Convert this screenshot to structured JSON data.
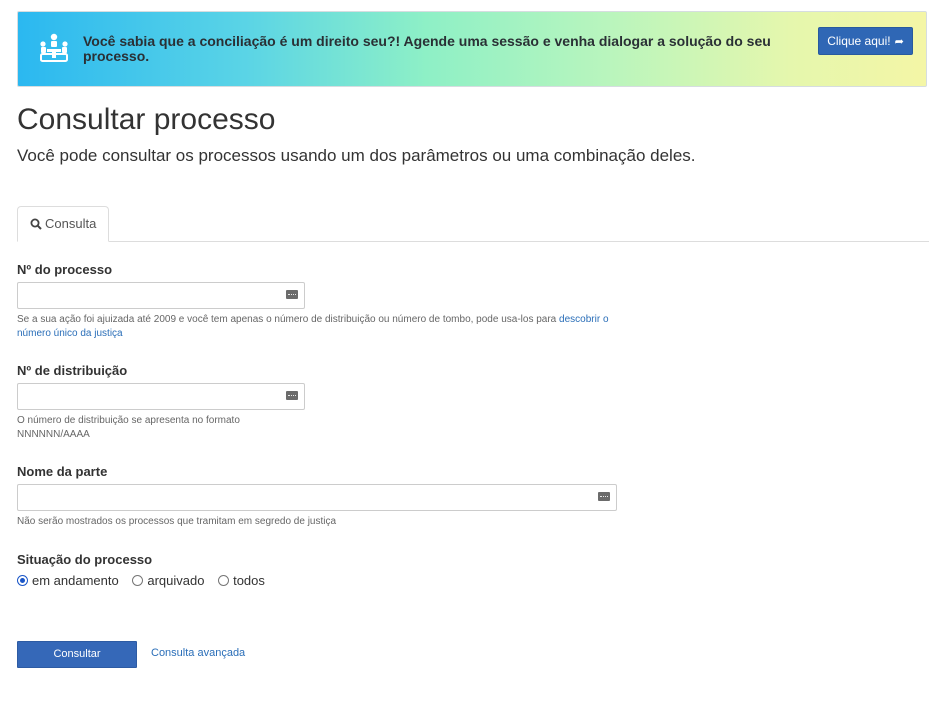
{
  "banner": {
    "message": "Você sabia que a conciliação é um direito seu?! Agende uma sessão e venha dialogar a solução do seu processo.",
    "button_label": "Clique aqui!",
    "icon": "people-meeting-icon",
    "button_icon": "share-arrow-icon"
  },
  "page": {
    "title": "Consultar processo",
    "subtitle": "Você pode consultar os processos usando um dos parâmetros ou uma combinação deles."
  },
  "tabs": [
    {
      "label": "Consulta",
      "icon": "search-icon",
      "active": true
    }
  ],
  "form": {
    "numero_processo": {
      "label": "Nº do processo",
      "value": "",
      "placeholder": "",
      "help_text": "Se a sua ação foi ajuizada até 2009 e você tem apenas o número de distribuição ou número de tombo, pode usa-los para ",
      "help_link": "descobrir o número único da justiça"
    },
    "numero_distribuicao": {
      "label": "Nº de distribuição",
      "value": "",
      "placeholder": "",
      "help_line1": "O número de distribuição se apresenta no formato",
      "help_line2": "NNNNNN/AAAA"
    },
    "nome_parte": {
      "label": "Nome da parte",
      "value": "",
      "placeholder": "",
      "help_text": "Não serão mostrados os processos que tramitam em segredo de justiça"
    },
    "situacao": {
      "label": "Situação do processo",
      "options": [
        "em andamento",
        "arquivado",
        "todos"
      ],
      "selected": "em andamento"
    }
  },
  "actions": {
    "submit_label": "Consultar",
    "advanced_label": "Consulta avançada"
  },
  "colors": {
    "primary": "#3568b8",
    "link": "#2a6eb8",
    "banner_gradient_start": "#2bb8f0",
    "banner_gradient_end": "#f4f6a6"
  }
}
